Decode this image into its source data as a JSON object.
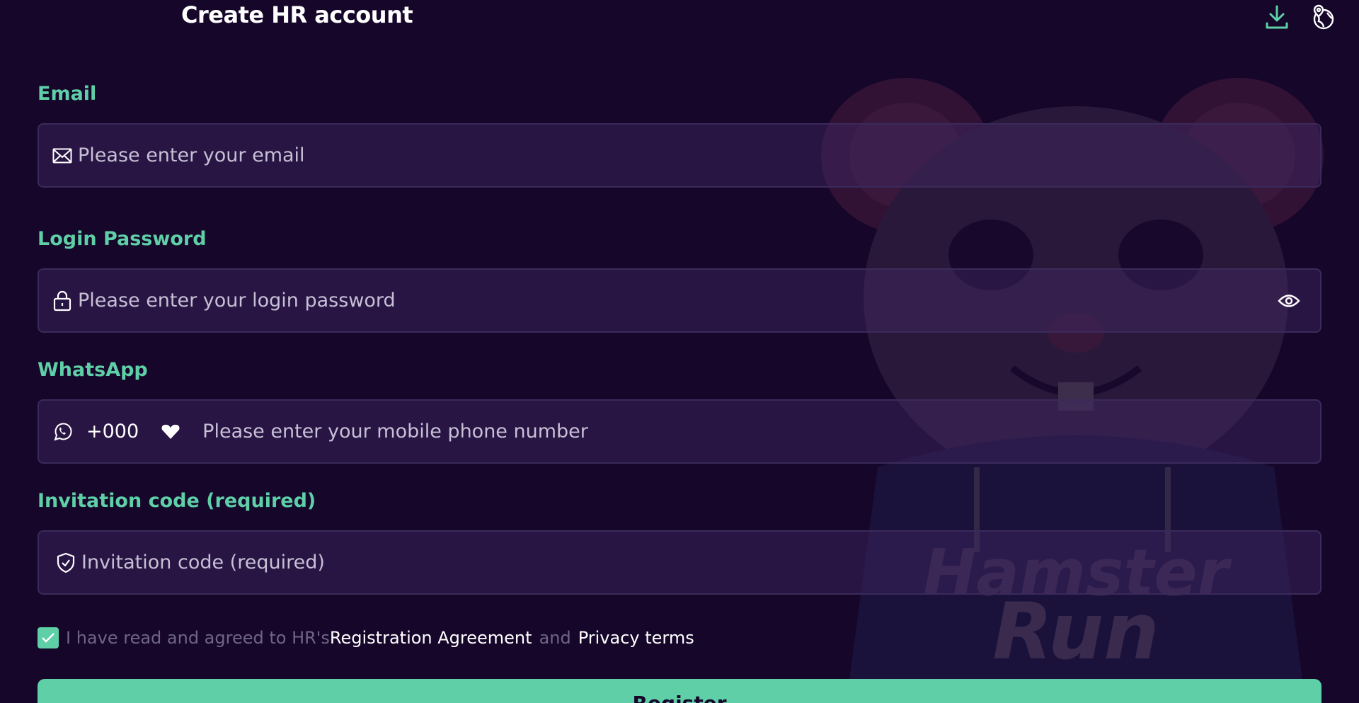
{
  "header": {
    "title": "Create HR account",
    "download_icon": "download-icon",
    "language_icon": "globe-location-icon"
  },
  "email": {
    "label": "Email",
    "placeholder": "Please enter your email",
    "icon": "mail-icon"
  },
  "password": {
    "label": "Login Password",
    "placeholder": "Please enter your login password",
    "icon": "lock-icon",
    "toggle_icon": "eye-icon"
  },
  "whatsapp": {
    "label": "WhatsApp",
    "country_code": "+000",
    "placeholder": "Please enter your mobile phone number",
    "icon": "whatsapp-icon"
  },
  "invitation": {
    "label": "Invitation code (required)",
    "placeholder": "Invitation code (required)",
    "icon": "shield-check-icon"
  },
  "agreement": {
    "checked": true,
    "prefix": "I have read and agreed to HR's",
    "registration_link": "Registration Agreement",
    "and": "and",
    "privacy_link": "Privacy terms"
  },
  "register_button": "Register",
  "background_art": {
    "text_line1": "Hamster",
    "text_line2": "Run"
  },
  "colors": {
    "background": "#15062a",
    "accent": "#5fcfa7",
    "field_bg": "#2a1a44",
    "muted_text": "#6f6585"
  }
}
